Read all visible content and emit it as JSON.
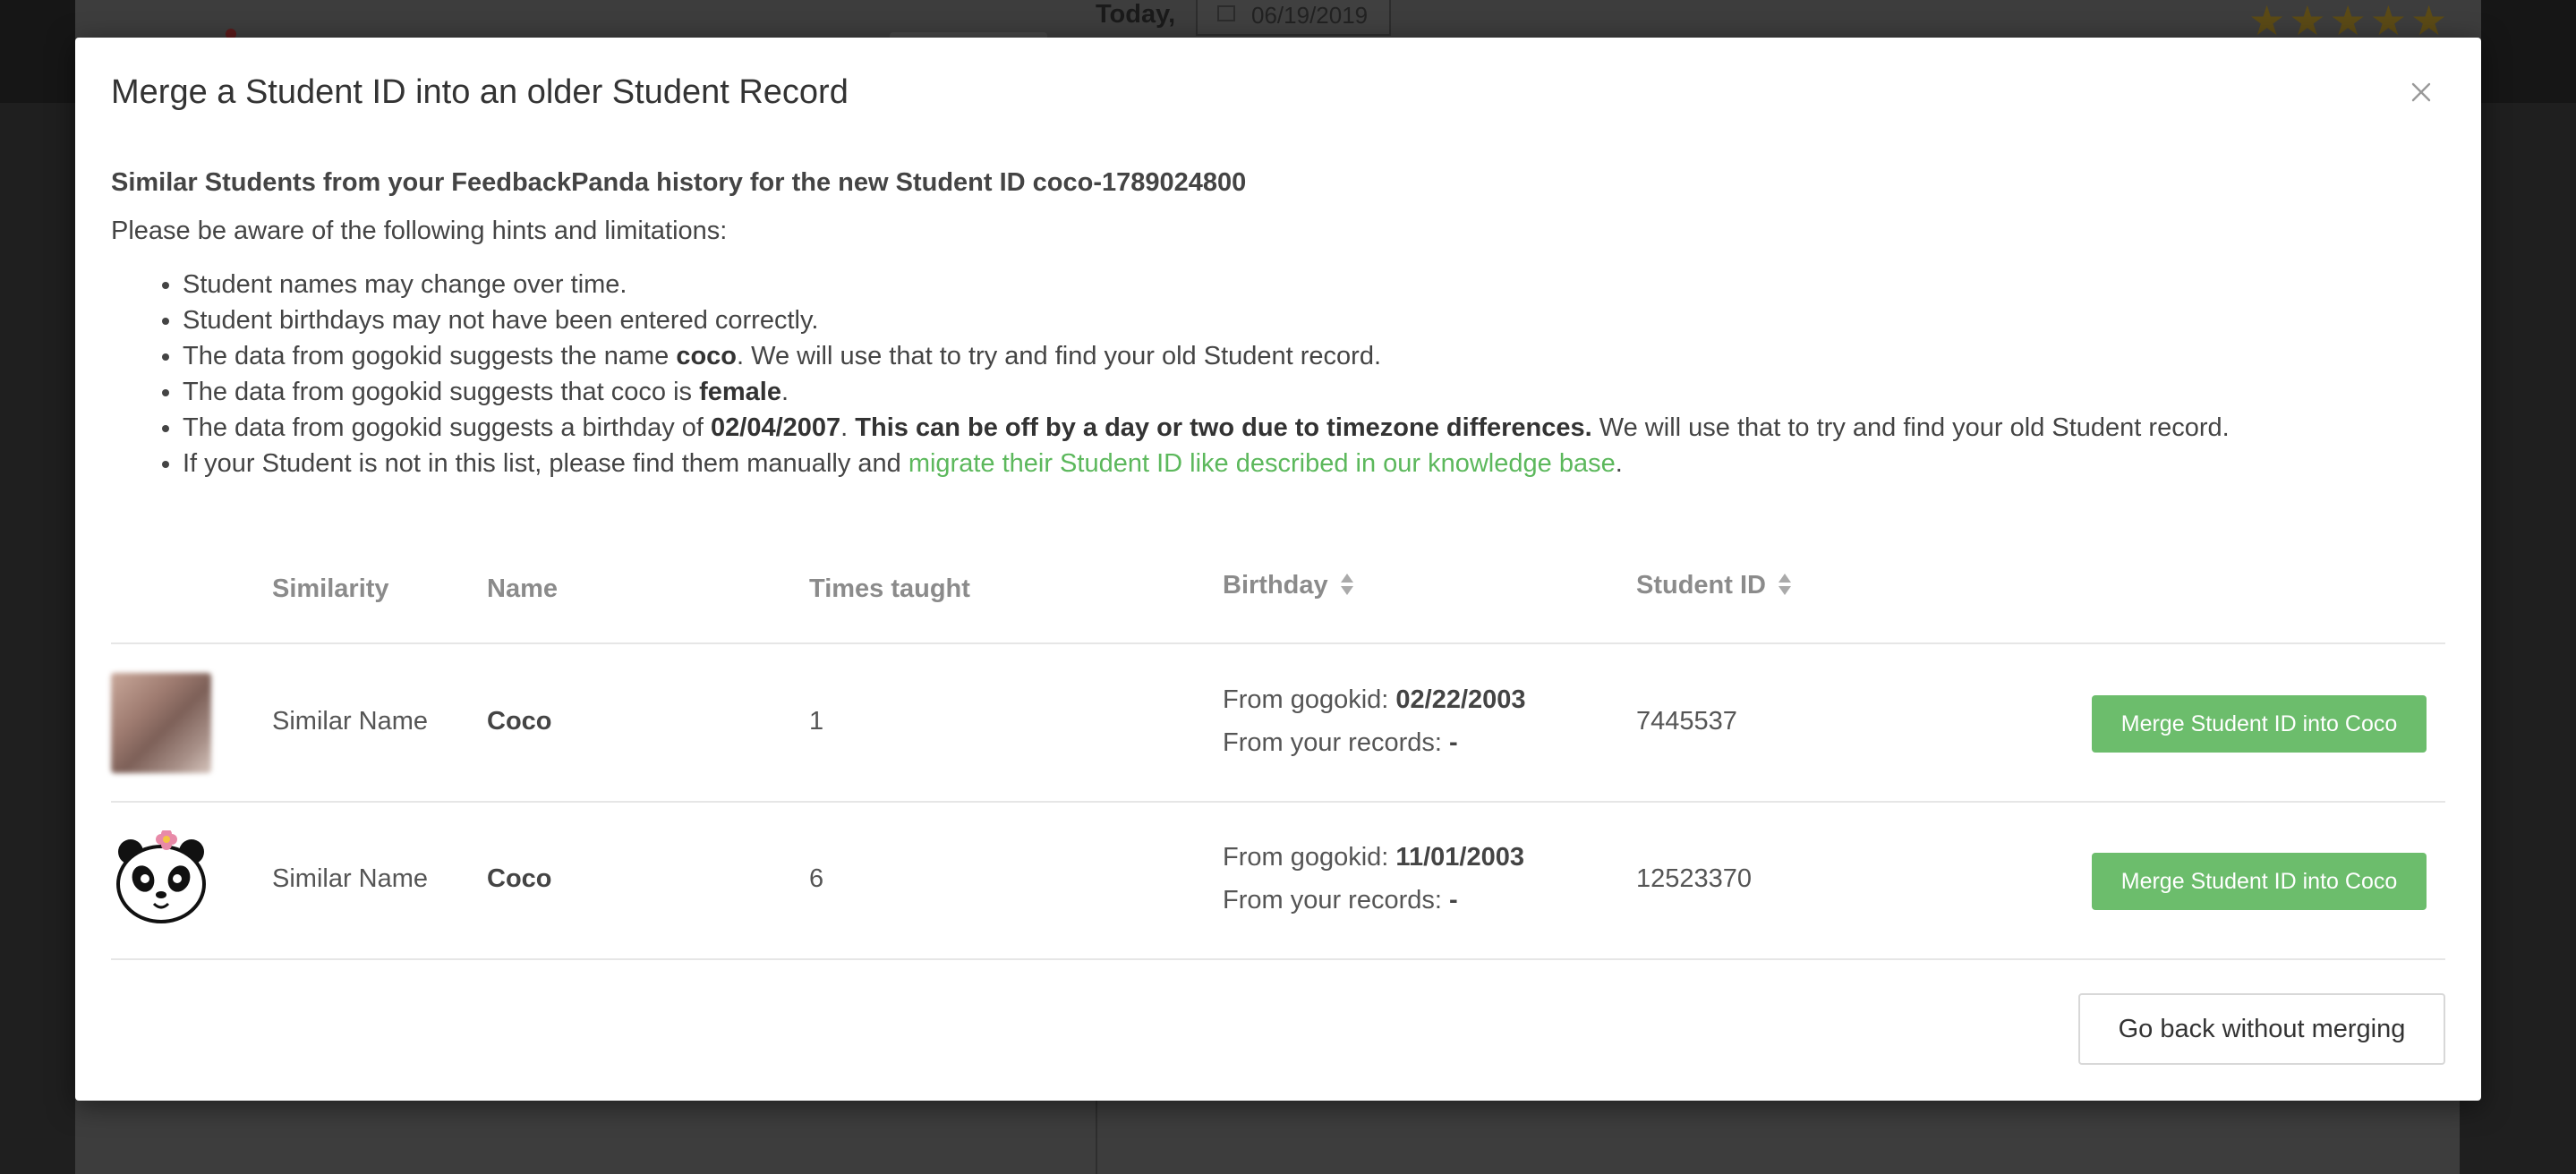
{
  "background": {
    "today_label": "Today,",
    "date_value": "06/19/2019",
    "stars": "★★★★★"
  },
  "modal": {
    "title": "Merge a Student ID into an older Student Record",
    "subtitle": "Similar Students from your FeedbackPanda history for the new Student ID coco-1789024800",
    "hint_intro": "Please be aware of the following hints and limitations:",
    "hints": {
      "h1": "Student names may change over time.",
      "h2": "Student birthdays may not have been entered correctly.",
      "h3_pre": "The data from gogokid suggests the name ",
      "h3_bold": "coco",
      "h3_post": ". We will use that to try and find your old Student record.",
      "h4_pre": "The data from gogokid suggests that coco is ",
      "h4_bold": "female",
      "h4_post": ".",
      "h5_pre": "The data from gogokid suggests a birthday of ",
      "h5_bold1": "02/04/2007",
      "h5_mid": ". ",
      "h5_bold2": "This can be off by a day or two due to timezone differences.",
      "h5_post": " We will use that to try and find your old Student record.",
      "h6_pre": "If your Student is not in this list, please find them manually and ",
      "h6_link": "migrate their Student ID like described in our knowledge base",
      "h6_post": "."
    },
    "table": {
      "headers": {
        "similarity": "Similarity",
        "name": "Name",
        "times_taught": "Times taught",
        "birthday": "Birthday",
        "student_id": "Student ID"
      },
      "rows": [
        {
          "similarity": "Similar Name",
          "name": "Coco",
          "times_taught": "1",
          "gogokid_label": "From gogokid: ",
          "gogokid_birthday": "02/22/2003",
          "records_label": "From your records: ",
          "records_birthday": "-",
          "student_id": "7445537",
          "button": "Merge Student ID into Coco",
          "avatar": "blurred-photo"
        },
        {
          "similarity": "Similar Name",
          "name": "Coco",
          "times_taught": "6",
          "gogokid_label": "From gogokid: ",
          "gogokid_birthday": "11/01/2003",
          "records_label": "From your records: ",
          "records_birthday": "-",
          "student_id": "12523370",
          "button": "Merge Student ID into Coco",
          "avatar": "panda-icon"
        }
      ]
    },
    "back_button": "Go back without merging",
    "colors": {
      "accent_green": "#6cbd6c",
      "link_green": "#5cb85c",
      "overlay": "#1f1f1f"
    }
  }
}
